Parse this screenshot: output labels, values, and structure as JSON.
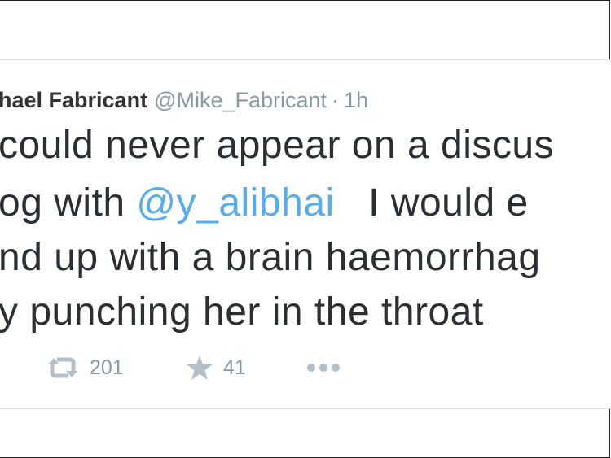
{
  "tweet": {
    "author_name": "hael Fabricant",
    "author_handle": "@Mike_Fabricant",
    "separator": "·",
    "timestamp": "1h",
    "lines": [
      {
        "text": "could never appear on a discus"
      },
      {
        "prefix": "og with ",
        "mention": "@y_alibhai",
        "suffix": "   I would e"
      },
      {
        "text": "nd up with a brain haemorrhag"
      },
      {
        "text": "y punching her in the throat"
      }
    ],
    "retweet_count": "201",
    "favorite_count": "41",
    "icons": {
      "retweet": "retweet-icon",
      "favorite": "star-icon",
      "more": "more-icon"
    },
    "colors": {
      "mention": "#55acee",
      "meta": "#8899a6",
      "text": "#292f33",
      "icon": "#b4c0c9"
    }
  }
}
